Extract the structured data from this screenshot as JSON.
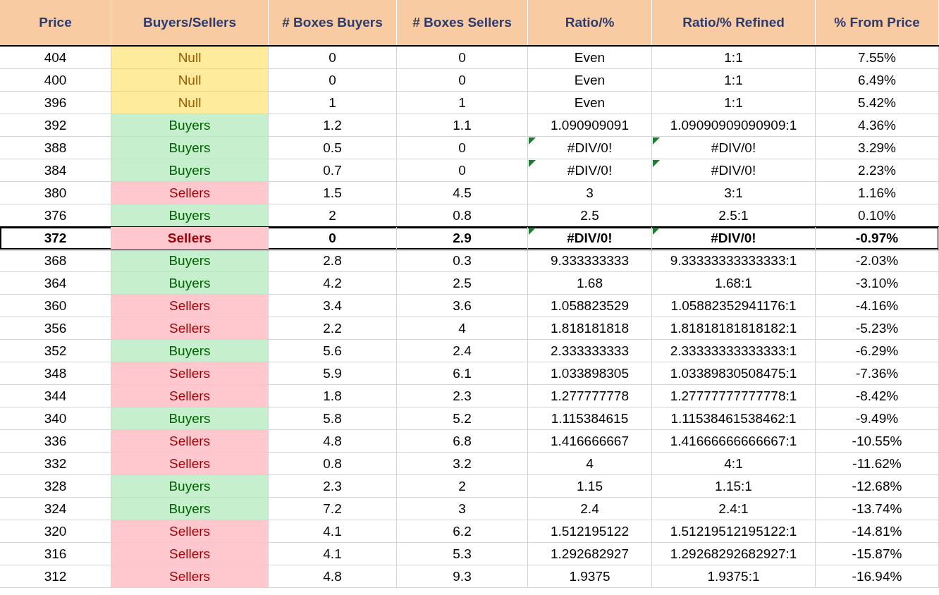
{
  "table": {
    "columns": [
      "Price",
      "Buyers/Sellers",
      "# Boxes Buyers",
      "# Boxes Sellers",
      "Ratio/%",
      "Ratio/% Refined",
      "% From Price"
    ],
    "rows": [
      {
        "price": "404",
        "side": "Null",
        "kind": "null",
        "boxes_buyers": "0",
        "boxes_sellers": "0",
        "ratio": "Even",
        "ratio_refined": "1:1",
        "from_price": "7.55%",
        "error_flag": false,
        "selected": false
      },
      {
        "price": "400",
        "side": "Null",
        "kind": "null",
        "boxes_buyers": "0",
        "boxes_sellers": "0",
        "ratio": "Even",
        "ratio_refined": "1:1",
        "from_price": "6.49%",
        "error_flag": false,
        "selected": false
      },
      {
        "price": "396",
        "side": "Null",
        "kind": "null",
        "boxes_buyers": "1",
        "boxes_sellers": "1",
        "ratio": "Even",
        "ratio_refined": "1:1",
        "from_price": "5.42%",
        "error_flag": false,
        "selected": false
      },
      {
        "price": "392",
        "side": "Buyers",
        "kind": "buyers",
        "boxes_buyers": "1.2",
        "boxes_sellers": "1.1",
        "ratio": "1.090909091",
        "ratio_refined": "1.09090909090909:1",
        "from_price": "4.36%",
        "error_flag": false,
        "selected": false
      },
      {
        "price": "388",
        "side": "Buyers",
        "kind": "buyers",
        "boxes_buyers": "0.5",
        "boxes_sellers": "0",
        "ratio": "#DIV/0!",
        "ratio_refined": "#DIV/0!",
        "from_price": "3.29%",
        "error_flag": true,
        "selected": false
      },
      {
        "price": "384",
        "side": "Buyers",
        "kind": "buyers",
        "boxes_buyers": "0.7",
        "boxes_sellers": "0",
        "ratio": "#DIV/0!",
        "ratio_refined": "#DIV/0!",
        "from_price": "2.23%",
        "error_flag": true,
        "selected": false
      },
      {
        "price": "380",
        "side": "Sellers",
        "kind": "sellers",
        "boxes_buyers": "1.5",
        "boxes_sellers": "4.5",
        "ratio": "3",
        "ratio_refined": "3:1",
        "from_price": "1.16%",
        "error_flag": false,
        "selected": false
      },
      {
        "price": "376",
        "side": "Buyers",
        "kind": "buyers",
        "boxes_buyers": "2",
        "boxes_sellers": "0.8",
        "ratio": "2.5",
        "ratio_refined": "2.5:1",
        "from_price": "0.10%",
        "error_flag": false,
        "selected": false
      },
      {
        "price": "372",
        "side": "Sellers",
        "kind": "sellers",
        "boxes_buyers": "0",
        "boxes_sellers": "2.9",
        "ratio": "#DIV/0!",
        "ratio_refined": "#DIV/0!",
        "from_price": "-0.97%",
        "error_flag": true,
        "selected": true
      },
      {
        "price": "368",
        "side": "Buyers",
        "kind": "buyers",
        "boxes_buyers": "2.8",
        "boxes_sellers": "0.3",
        "ratio": "9.333333333",
        "ratio_refined": "9.33333333333333:1",
        "from_price": "-2.03%",
        "error_flag": false,
        "selected": false
      },
      {
        "price": "364",
        "side": "Buyers",
        "kind": "buyers",
        "boxes_buyers": "4.2",
        "boxes_sellers": "2.5",
        "ratio": "1.68",
        "ratio_refined": "1.68:1",
        "from_price": "-3.10%",
        "error_flag": false,
        "selected": false
      },
      {
        "price": "360",
        "side": "Sellers",
        "kind": "sellers",
        "boxes_buyers": "3.4",
        "boxes_sellers": "3.6",
        "ratio": "1.058823529",
        "ratio_refined": "1.05882352941176:1",
        "from_price": "-4.16%",
        "error_flag": false,
        "selected": false
      },
      {
        "price": "356",
        "side": "Sellers",
        "kind": "sellers",
        "boxes_buyers": "2.2",
        "boxes_sellers": "4",
        "ratio": "1.818181818",
        "ratio_refined": "1.81818181818182:1",
        "from_price": "-5.23%",
        "error_flag": false,
        "selected": false
      },
      {
        "price": "352",
        "side": "Buyers",
        "kind": "buyers",
        "boxes_buyers": "5.6",
        "boxes_sellers": "2.4",
        "ratio": "2.333333333",
        "ratio_refined": "2.33333333333333:1",
        "from_price": "-6.29%",
        "error_flag": false,
        "selected": false
      },
      {
        "price": "348",
        "side": "Sellers",
        "kind": "sellers",
        "boxes_buyers": "5.9",
        "boxes_sellers": "6.1",
        "ratio": "1.033898305",
        "ratio_refined": "1.03389830508475:1",
        "from_price": "-7.36%",
        "error_flag": false,
        "selected": false
      },
      {
        "price": "344",
        "side": "Sellers",
        "kind": "sellers",
        "boxes_buyers": "1.8",
        "boxes_sellers": "2.3",
        "ratio": "1.277777778",
        "ratio_refined": "1.27777777777778:1",
        "from_price": "-8.42%",
        "error_flag": false,
        "selected": false
      },
      {
        "price": "340",
        "side": "Buyers",
        "kind": "buyers",
        "boxes_buyers": "5.8",
        "boxes_sellers": "5.2",
        "ratio": "1.115384615",
        "ratio_refined": "1.11538461538462:1",
        "from_price": "-9.49%",
        "error_flag": false,
        "selected": false
      },
      {
        "price": "336",
        "side": "Sellers",
        "kind": "sellers",
        "boxes_buyers": "4.8",
        "boxes_sellers": "6.8",
        "ratio": "1.416666667",
        "ratio_refined": "1.41666666666667:1",
        "from_price": "-10.55%",
        "error_flag": false,
        "selected": false
      },
      {
        "price": "332",
        "side": "Sellers",
        "kind": "sellers",
        "boxes_buyers": "0.8",
        "boxes_sellers": "3.2",
        "ratio": "4",
        "ratio_refined": "4:1",
        "from_price": "-11.62%",
        "error_flag": false,
        "selected": false
      },
      {
        "price": "328",
        "side": "Buyers",
        "kind": "buyers",
        "boxes_buyers": "2.3",
        "boxes_sellers": "2",
        "ratio": "1.15",
        "ratio_refined": "1.15:1",
        "from_price": "-12.68%",
        "error_flag": false,
        "selected": false
      },
      {
        "price": "324",
        "side": "Buyers",
        "kind": "buyers",
        "boxes_buyers": "7.2",
        "boxes_sellers": "3",
        "ratio": "2.4",
        "ratio_refined": "2.4:1",
        "from_price": "-13.74%",
        "error_flag": false,
        "selected": false
      },
      {
        "price": "320",
        "side": "Sellers",
        "kind": "sellers",
        "boxes_buyers": "4.1",
        "boxes_sellers": "6.2",
        "ratio": "1.512195122",
        "ratio_refined": "1.51219512195122:1",
        "from_price": "-14.81%",
        "error_flag": false,
        "selected": false
      },
      {
        "price": "316",
        "side": "Sellers",
        "kind": "sellers",
        "boxes_buyers": "4.1",
        "boxes_sellers": "5.3",
        "ratio": "1.292682927",
        "ratio_refined": "1.29268292682927:1",
        "from_price": "-15.87%",
        "error_flag": false,
        "selected": false
      },
      {
        "price": "312",
        "side": "Sellers",
        "kind": "sellers",
        "boxes_buyers": "4.8",
        "boxes_sellers": "9.3",
        "ratio": "1.9375",
        "ratio_refined": "1.9375:1",
        "from_price": "-16.94%",
        "error_flag": false,
        "selected": false
      }
    ]
  }
}
